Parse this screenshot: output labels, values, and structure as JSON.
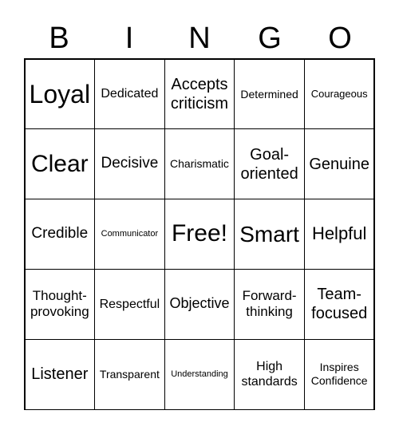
{
  "header": [
    "B",
    "I",
    "N",
    "G",
    "O"
  ],
  "cells": [
    "Loyal",
    "Dedicated",
    "Accepts criticism",
    "Determined",
    "Courageous",
    "Clear",
    "Decisive",
    "Charismatic",
    "Goal-oriented",
    "Genuine",
    "Credible",
    "Communicator",
    "Free!",
    "Smart",
    "Helpful",
    "Thought-provoking",
    "Respectful",
    "Objective",
    "Forward-thinking",
    "Team-focused",
    "Listener",
    "Transparent",
    "Understanding",
    "High standards",
    "Inspires Confidence"
  ]
}
